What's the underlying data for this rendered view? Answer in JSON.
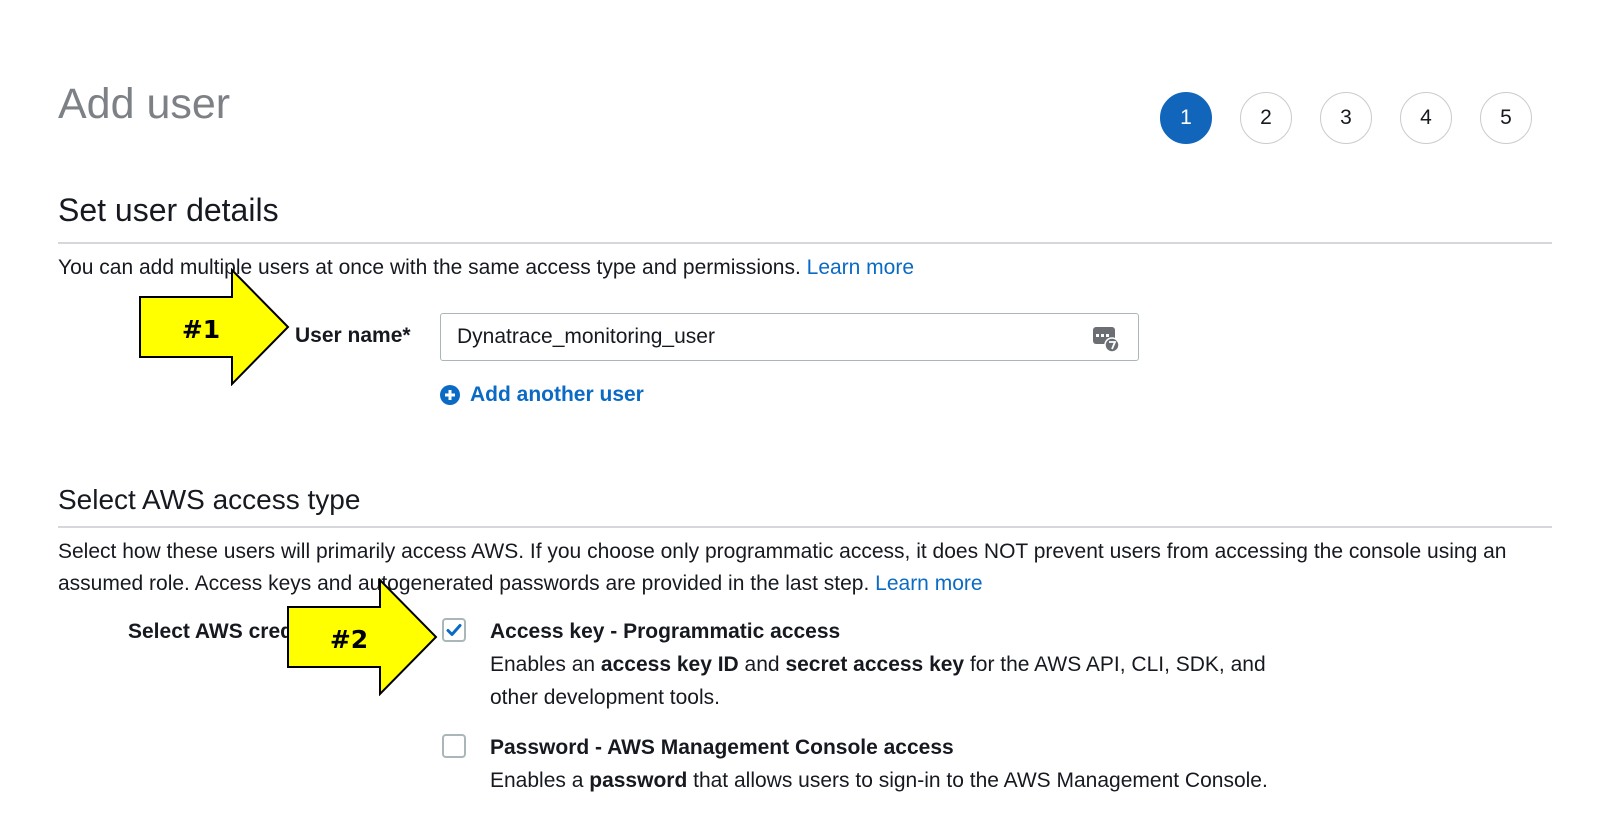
{
  "page": {
    "title": "Add user"
  },
  "steps": [
    {
      "label": "1",
      "active": true
    },
    {
      "label": "2",
      "active": false
    },
    {
      "label": "3",
      "active": false
    },
    {
      "label": "4",
      "active": false
    },
    {
      "label": "5",
      "active": false
    }
  ],
  "details": {
    "heading": "Set user details",
    "description": "You can add multiple users at once with the same access type and permissions.",
    "learn_more": "Learn more",
    "user_name_label": "User name*",
    "user_name_value": "Dynatrace_monitoring_user",
    "add_another_user": "Add another user"
  },
  "access": {
    "heading": "Select AWS access type",
    "description": "Select how these users will primarily access AWS. If you choose only programmatic access, it does NOT prevent users from accessing the console using an assumed role. Access keys and autogenerated passwords are provided in the last step.",
    "learn_more": "Learn more",
    "credential_label": "Select AWS credential type*",
    "options": [
      {
        "title": "Access key - Programmatic access",
        "checked": true,
        "desc_parts": [
          "Enables an ",
          "access key ID",
          " and ",
          "secret access key",
          " for the AWS API, CLI, SDK, and other development tools."
        ]
      },
      {
        "title": "Password - AWS Management Console access",
        "checked": false,
        "desc_parts": [
          "Enables a ",
          "password",
          " that allows users to sign-in to the AWS Management Console."
        ]
      }
    ]
  },
  "annotations": [
    {
      "label": "#1",
      "color": "#ffff00"
    },
    {
      "label": "#2",
      "color": "#ffff00"
    }
  ],
  "colors": {
    "accent": "#1166bb",
    "link": "#0b6bc4",
    "annotation": "#ffff00"
  }
}
